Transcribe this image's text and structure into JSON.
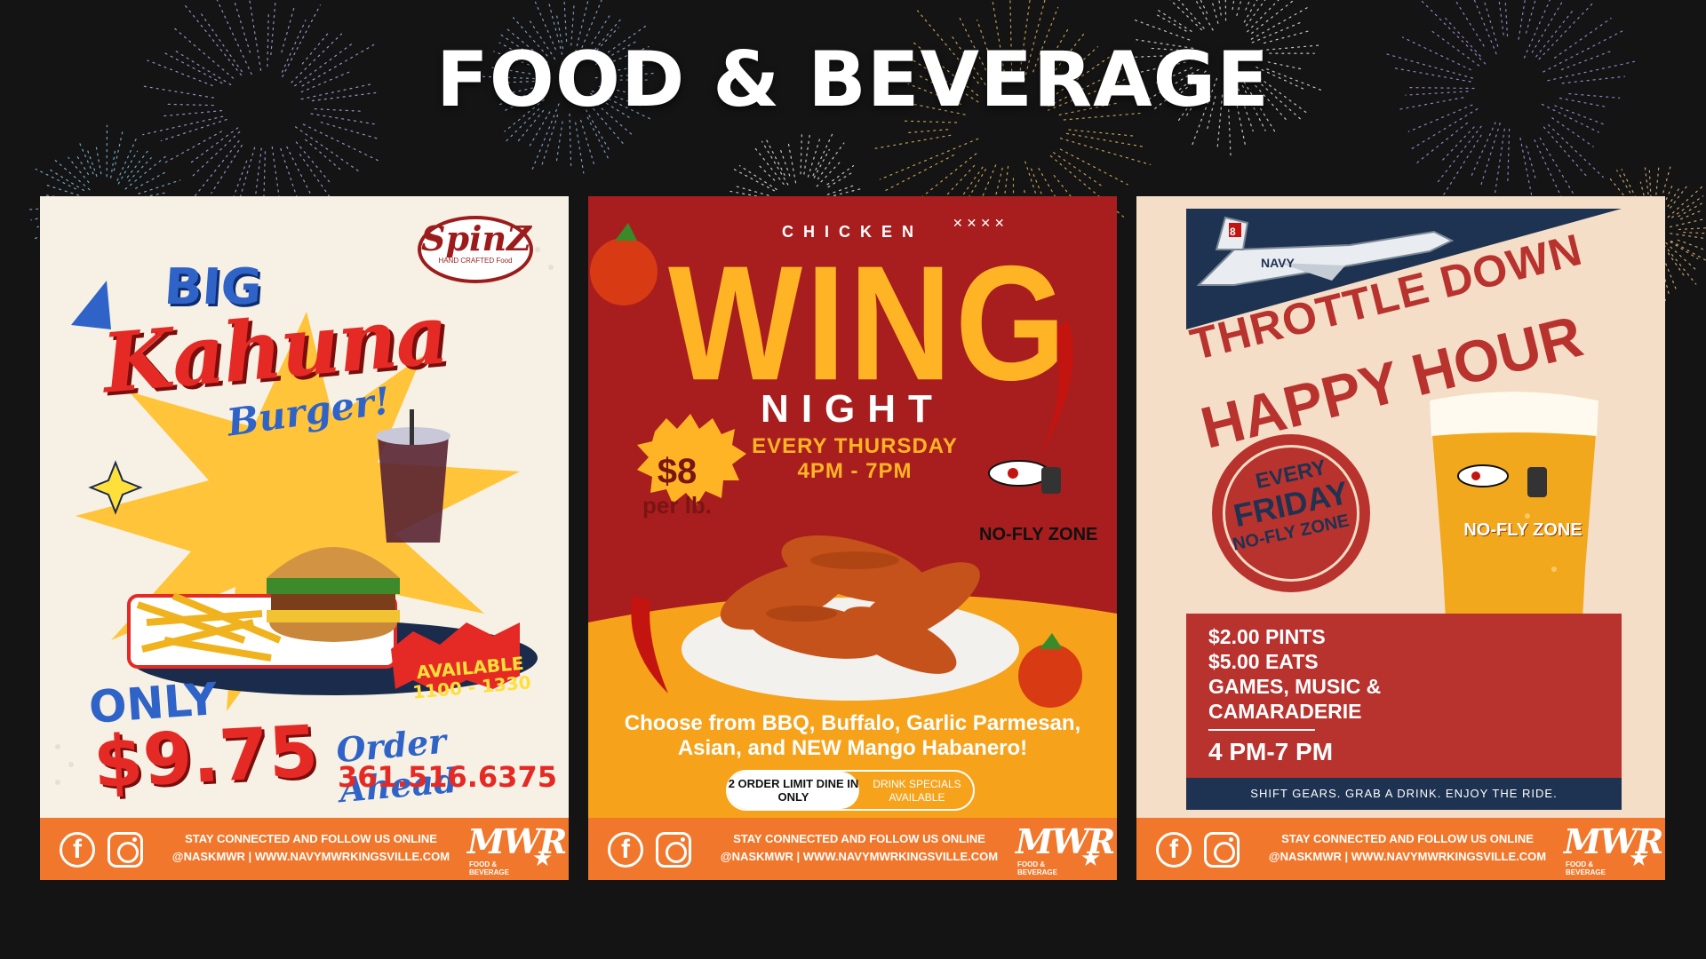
{
  "page": {
    "title": "FOOD & BEVERAGE",
    "background": "#141414"
  },
  "footer": {
    "line1": "STAY CONNECTED AND FOLLOW US ONLINE",
    "line2": "@NASKMWR | WWW.NAVYMWRKINGSVILLE.COM",
    "logo_text": "MWR",
    "logo_sub": "FOOD & BEVERAGE",
    "color": "#f0772b"
  },
  "posters": [
    {
      "brand": "SpinZ",
      "brand_sub": "HAND CRAFTED Food",
      "big": "BIG",
      "kahuna": "Kahuna",
      "burger": "Burger!",
      "only": "ONLY",
      "price": "$9.75",
      "available": "AVAILABLE 1100 - 1330",
      "order": "Order Ahead",
      "phone": "361.516.6375"
    },
    {
      "chicken": "CHICKEN",
      "wing": "WING",
      "night": "NIGHT",
      "day": "EVERY THURSDAY",
      "time": "4PM - 7PM",
      "price_a": "$8",
      "price_b": "per lb.",
      "nofly": "NO-FLY ZONE",
      "choose": "Choose from BBQ, Buffalo, Garlic Parmesan, Asian, and NEW Mango Habanero!",
      "limit": "2 ORDER LIMIT DINE IN ONLY",
      "drinks": "DRINK SPECIALS AVAILABLE"
    },
    {
      "throttle": "THROTTLE DOWN",
      "happy": "HAPPY HOUR",
      "every": "EVERY",
      "friday": "FRIDAY",
      "nofly": "NO-FLY ZONE",
      "glass_label": "NO-FLY ZONE",
      "pints": "$2.00 PINTS",
      "eats": "$5.00 EATS",
      "games": "GAMES, MUSIC &",
      "camaraderie": "CAMARADERIE",
      "time": "4 PM-7 PM",
      "tagline": "SHIFT GEARS. GRAB A DRINK. ENJOY THE RIDE.",
      "jet_tail": "8",
      "jet_label": "NAVY"
    }
  ]
}
